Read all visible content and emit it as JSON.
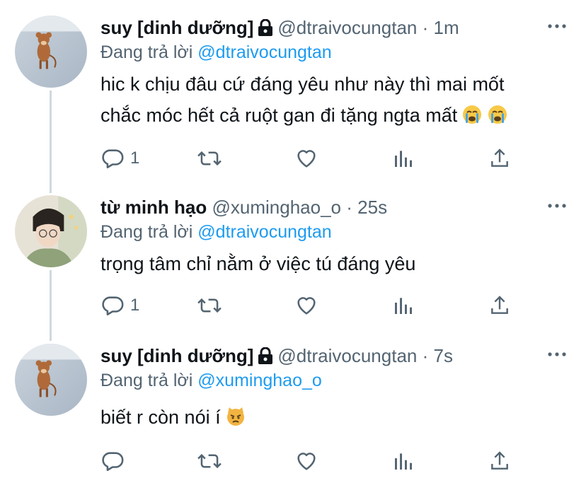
{
  "tweets": [
    {
      "name": "suy [dinh dưỡng]",
      "handle": "@dtraivocungtan",
      "time": "1m",
      "replying_prefix": "Đang trả lời",
      "replying_to": "@dtraivocungtan",
      "text_lines": [
        "hic k chịu đâu cứ đáng yêu như này thì mai mốt",
        "chắc móc hết cả ruột gan đi tặng ngta mất"
      ],
      "emojis": [
        "crying-face",
        "crying-face"
      ],
      "reply_count": "1",
      "protected": true
    },
    {
      "name": "từ minh hạo",
      "handle": "@xuminghao_o",
      "time": "25s",
      "replying_prefix": "Đang trả lời",
      "replying_to": "@dtraivocungtan",
      "text_lines": [
        "trọng tâm chỉ nằm ở việc tú đáng yêu"
      ],
      "reply_count": "1",
      "protected": false
    },
    {
      "name": "suy [dinh dưỡng]",
      "handle": "@dtraivocungtan",
      "time": "7s",
      "replying_prefix": "Đang trả lời",
      "replying_to": "@xuminghao_o",
      "text_lines": [
        "biết r còn nói í"
      ],
      "emojis": [
        "pouting-cat-face"
      ],
      "reply_count": "",
      "protected": true
    }
  ],
  "separator": "·",
  "colors": {
    "accent": "#1d9bf0",
    "secondary_text": "#536471",
    "primary_text": "#0f1419",
    "thread_line": "#cfd9de"
  }
}
